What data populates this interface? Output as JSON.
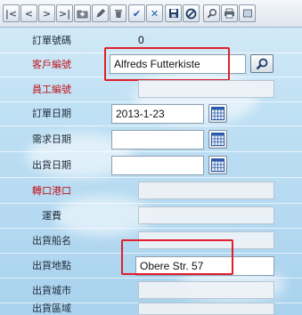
{
  "toolbar": {
    "buttons": [
      {
        "name": "first-record-button",
        "icon": "first-icon",
        "glyph": "K"
      },
      {
        "name": "previous-record-button",
        "icon": "previous-icon",
        "glyph": "<"
      },
      {
        "name": "next-record-button",
        "icon": "next-icon",
        "glyph": ">"
      },
      {
        "name": "last-record-button",
        "icon": "last-icon",
        "glyph": ">|"
      },
      {
        "name": "new-record-button",
        "icon": "new-folder-icon",
        "glyph": ""
      },
      {
        "name": "edit-record-button",
        "icon": "pencil-icon",
        "glyph": ""
      },
      {
        "name": "delete-record-button",
        "icon": "trash-icon",
        "glyph": ""
      },
      {
        "name": "confirm-button",
        "icon": "checkmark-icon",
        "glyph": "✔"
      },
      {
        "name": "cancel-button",
        "icon": "x-icon",
        "glyph": "✕"
      },
      {
        "name": "save-button",
        "icon": "disk-icon",
        "glyph": ""
      },
      {
        "name": "abort-button",
        "icon": "no-entry-icon",
        "glyph": "⊘"
      },
      {
        "name": "search-button",
        "icon": "magnifier-icon",
        "glyph": ""
      },
      {
        "name": "print-button",
        "icon": "printer-icon",
        "glyph": ""
      },
      {
        "name": "more-button",
        "icon": "more-icon",
        "glyph": ""
      }
    ]
  },
  "form": {
    "order_id": {
      "label": "訂單號碼",
      "value": "0"
    },
    "customer_id": {
      "label": "客戶編號",
      "value": "Alfreds Futterkiste"
    },
    "employee_id": {
      "label": "員工編號",
      "value": ""
    },
    "order_date": {
      "label": "訂單日期",
      "value": "2013-1-23"
    },
    "required_date": {
      "label": "需求日期",
      "value": ""
    },
    "shipped_date": {
      "label": "出貨日期",
      "value": ""
    },
    "ship_via": {
      "label": "轉口港口",
      "value": ""
    },
    "freight": {
      "label": "運費",
      "value": ""
    },
    "ship_name": {
      "label": "出貨船名",
      "value": ""
    },
    "ship_address": {
      "label": "出貨地點",
      "value": "Obere Str. 57"
    },
    "ship_city": {
      "label": "出貨城市",
      "value": ""
    },
    "ship_region": {
      "label": "出貨區域",
      "value": ""
    }
  },
  "colors": {
    "required_label": "#c0151c",
    "highlight": "#e21e2b",
    "background": "#bfe0f4"
  }
}
